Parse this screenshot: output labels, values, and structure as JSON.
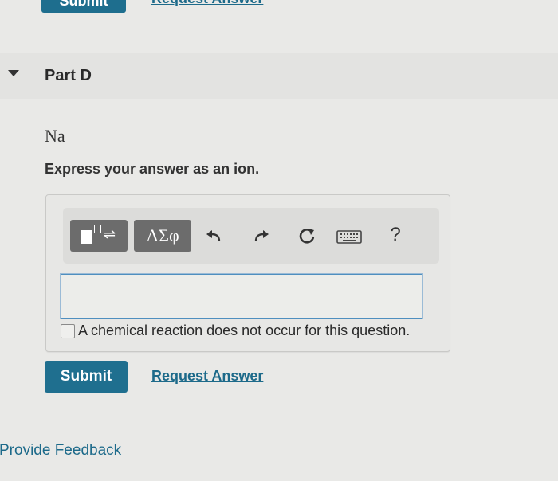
{
  "top": {
    "submit_label": "Submit",
    "request_label": "Request Answer"
  },
  "part": {
    "title": "Part D",
    "element": "Na",
    "instruction": "Express your answer as an ion."
  },
  "toolbar": {
    "symbols_label": "ΑΣφ",
    "icons": [
      "templates-icon",
      "undo-icon",
      "redo-icon",
      "reset-icon",
      "keyboard-icon",
      "help-icon"
    ],
    "help_label": "?"
  },
  "answer": {
    "value": ""
  },
  "no_reaction_label": "A chemical reaction does not occur for this question.",
  "actions": {
    "submit_label": "Submit",
    "request_label": "Request Answer"
  },
  "feedback_label": "Provide Feedback",
  "colors": {
    "accent": "#1e6e8e",
    "link": "#1d6a8a",
    "input_border": "#4f8fbf"
  }
}
